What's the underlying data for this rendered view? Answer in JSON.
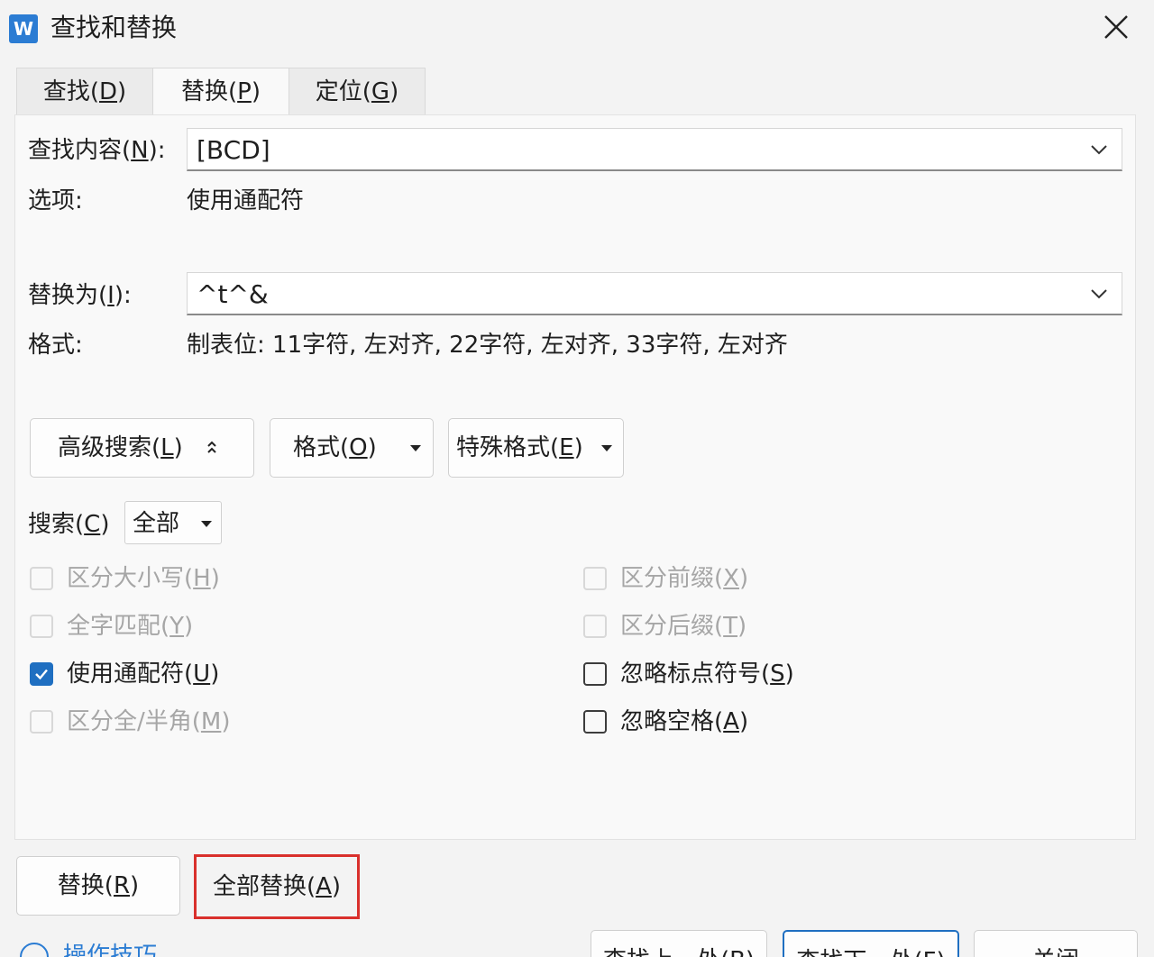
{
  "window": {
    "title": "查找和替换",
    "app_icon_letter": "W"
  },
  "tabs": [
    {
      "label_pre": "查找(",
      "key": "D",
      "label_post": ")"
    },
    {
      "label_pre": "替换(",
      "key": "P",
      "label_post": ")"
    },
    {
      "label_pre": "定位(",
      "key": "G",
      "label_post": ")"
    }
  ],
  "find": {
    "label_pre": "查找内容(",
    "key": "N",
    "label_post": "):",
    "value": "[BCD]"
  },
  "options": {
    "label": "选项:",
    "value": "使用通配符"
  },
  "replace": {
    "label_pre": "替换为(",
    "key": "I",
    "label_post": "):",
    "value": "^t^&"
  },
  "format_info": {
    "label": "格式:",
    "value": "制表位: 11字符, 左对齐, 22字符, 左对齐, 33字符, 左对齐"
  },
  "buttons": {
    "advanced_pre": "高级搜索(",
    "advanced_key": "L",
    "advanced_post": ")",
    "format_pre": "格式(",
    "format_key": "O",
    "format_post": ")",
    "special_pre": "特殊格式(",
    "special_key": "E",
    "special_post": ")"
  },
  "search": {
    "label_pre": "搜索(",
    "key": "C",
    "label_post": ")",
    "value": "全部"
  },
  "checkboxes_left": [
    {
      "label_pre": "区分大小写(",
      "key": "H",
      "label_post": ")",
      "checked": false,
      "enabled": false
    },
    {
      "label_pre": "全字匹配(",
      "key": "Y",
      "label_post": ")",
      "checked": false,
      "enabled": false
    },
    {
      "label_pre": "使用通配符(",
      "key": "U",
      "label_post": ")",
      "checked": true,
      "enabled": true
    },
    {
      "label_pre": "区分全/半角(",
      "key": "M",
      "label_post": ")",
      "checked": false,
      "enabled": false
    }
  ],
  "checkboxes_right": [
    {
      "label_pre": "区分前缀(",
      "key": "X",
      "label_post": ")",
      "checked": false,
      "enabled": false
    },
    {
      "label_pre": "区分后缀(",
      "key": "T",
      "label_post": ")",
      "checked": false,
      "enabled": false
    },
    {
      "label_pre": "忽略标点符号(",
      "key": "S",
      "label_post": ")",
      "checked": false,
      "enabled": true
    },
    {
      "label_pre": "忽略空格(",
      "key": "A",
      "label_post": ")",
      "checked": false,
      "enabled": true
    }
  ],
  "actions": {
    "replace_pre": "替换(",
    "replace_key": "R",
    "replace_post": ")",
    "replace_all_pre": "全部替换(",
    "replace_all_key": "A",
    "replace_all_post": ")",
    "find_prev": "查找上一处(B)",
    "find_next": "查找下一处(F)",
    "close": "关闭"
  },
  "tips": "操作技巧",
  "colors": {
    "accent": "#1f6fc1",
    "highlight": "#d9302c"
  }
}
